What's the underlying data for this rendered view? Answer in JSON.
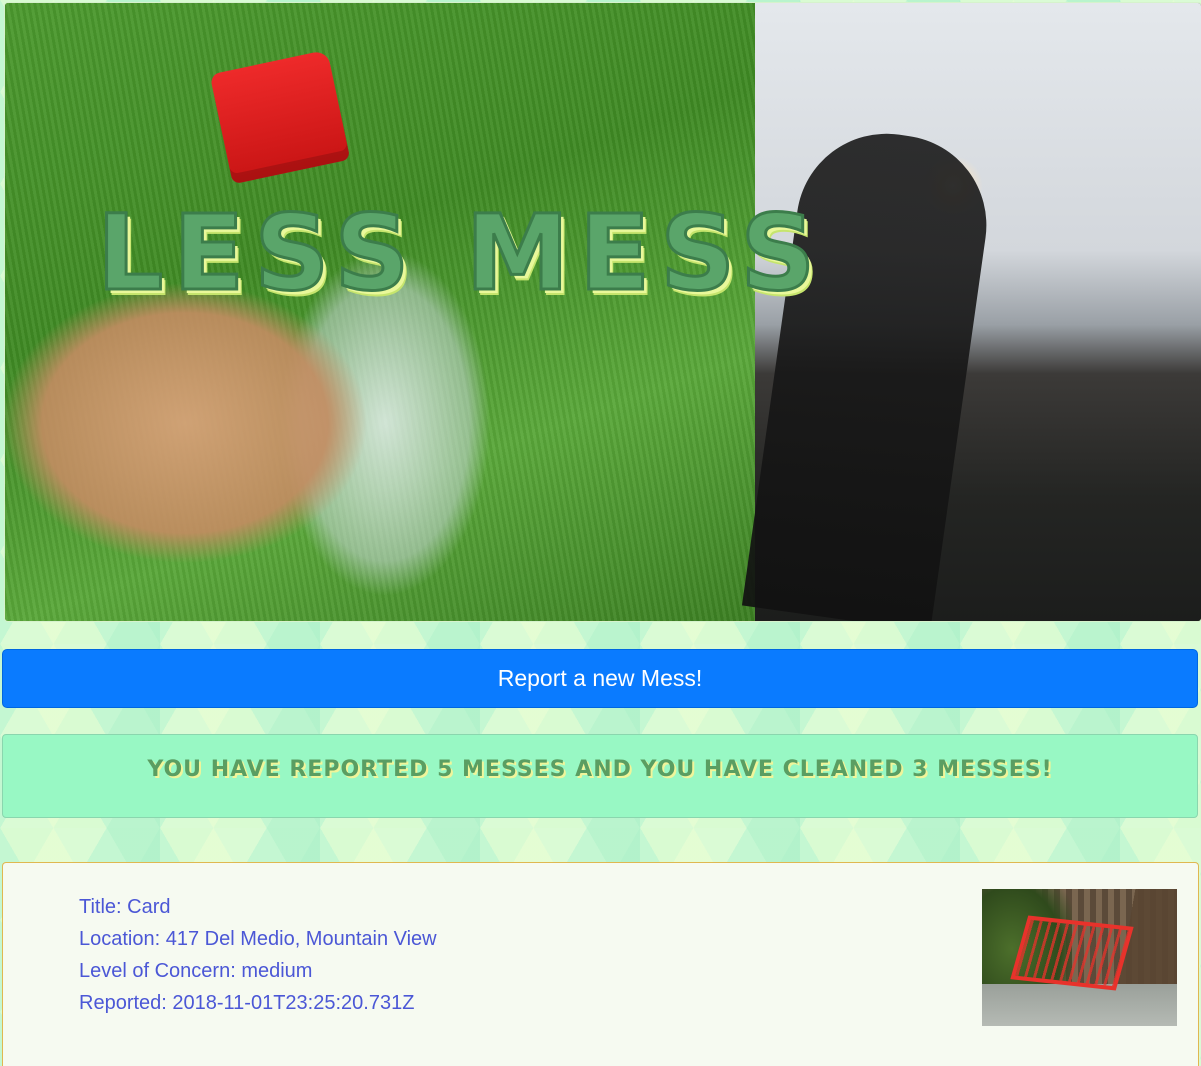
{
  "header": {
    "title": "Less Mess"
  },
  "actions": {
    "report_label": "Report a new Mess!"
  },
  "stats": {
    "text": "You have reported 5 messes and you have cleaned 3 messes!"
  },
  "messes": [
    {
      "title": "Title: Card",
      "location": "Location: 417 Del Medio, Mountain View",
      "concern": "Level of Concern: medium",
      "reported": "Reported: 2018-11-01T23:25:20.731Z"
    }
  ],
  "colors": {
    "primary_button": "#0a7bff",
    "banner_bg": "#98f8c4",
    "title_green": "#5aa56a",
    "detail_text": "#4b57d6"
  }
}
